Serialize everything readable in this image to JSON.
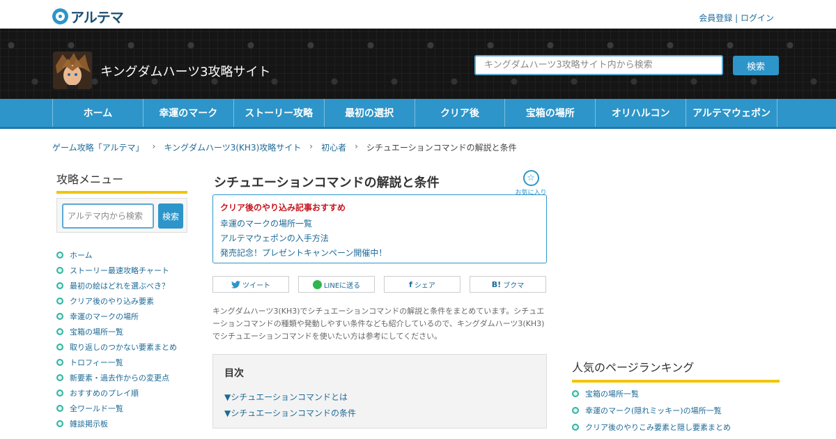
{
  "topbar": {
    "logo_text": "アルテマ",
    "register": "会員登録",
    "separator": "|",
    "login": "ログイン"
  },
  "header": {
    "site_title": "キングダムハーツ3攻略サイト",
    "search_placeholder": "キングダムハーツ3攻略サイト内から検索",
    "search_button": "検索"
  },
  "nav": {
    "items": [
      "ホーム",
      "幸運のマーク",
      "ストーリー攻略",
      "最初の選択",
      "クリア後",
      "宝箱の場所",
      "オリハルコン",
      "アルテマウェポン"
    ]
  },
  "breadcrumb": {
    "items": [
      "ゲーム攻略「アルテマ」",
      "キングダムハーツ3(KH3)攻略サイト",
      "初心者",
      "シチュエーションコマンドの解説と条件"
    ],
    "sep": "›"
  },
  "sidebar": {
    "title": "攻略メニュー",
    "search_placeholder": "アルテマ内から検索",
    "search_button": "検索",
    "items": [
      "ホーム",
      "ストーリー最速攻略チャート",
      "最初の絵はどれを選ぶべき？",
      "クリア後のやり込み要素",
      "幸運のマークの場所",
      "宝箱の場所一覧",
      "取り返しのつかない要素まとめ",
      "トロフィー一覧",
      "新要素・過去作からの変更点",
      "おすすめのプレイ順",
      "全ワールド一覧",
      "雑談掲示板"
    ]
  },
  "article": {
    "title": "シチュエーションコマンドの解説と条件",
    "fav_icon": "☆",
    "fav_label": "お気に入り",
    "notice": {
      "title": "クリア後のやり込み記事おすすめ",
      "links": [
        "幸運のマークの場所一覧",
        "アルテマウェポンの入手方法",
        "発売記念！プレゼントキャンペーン開催中！"
      ]
    },
    "share": [
      {
        "glyph": "🐦",
        "label": "ツイート"
      },
      {
        "glyph": "LINE",
        "label": "LINEに送る"
      },
      {
        "glyph": "f",
        "label": "シェア"
      },
      {
        "glyph": "B!",
        "label": "ブクマ"
      }
    ],
    "intro": "キングダムハーツ3(KH3)でシチュエーションコマンドの解説と条件をまとめています。シチュエーションコマンドの種類や発動しやすい条件なども紹介しているので、キングダムハーツ3(KH3)でシチュエーションコマンドを使いたい方は参考にしてください。",
    "toc": {
      "title": "目次",
      "items": [
        "▼シチュエーションコマンドとは",
        "▼シチュエーションコマンドの条件"
      ]
    }
  },
  "ranking": {
    "title": "人気のページランキング",
    "items": [
      "宝箱の場所一覧",
      "幸運のマーク(隠れミッキー)の場所一覧",
      "クリア後のやりこみ要素と隠し要素まとめ"
    ]
  },
  "colors": {
    "accent": "#2d95c9",
    "highlight": "#f2c500",
    "alert": "#c8141e"
  }
}
